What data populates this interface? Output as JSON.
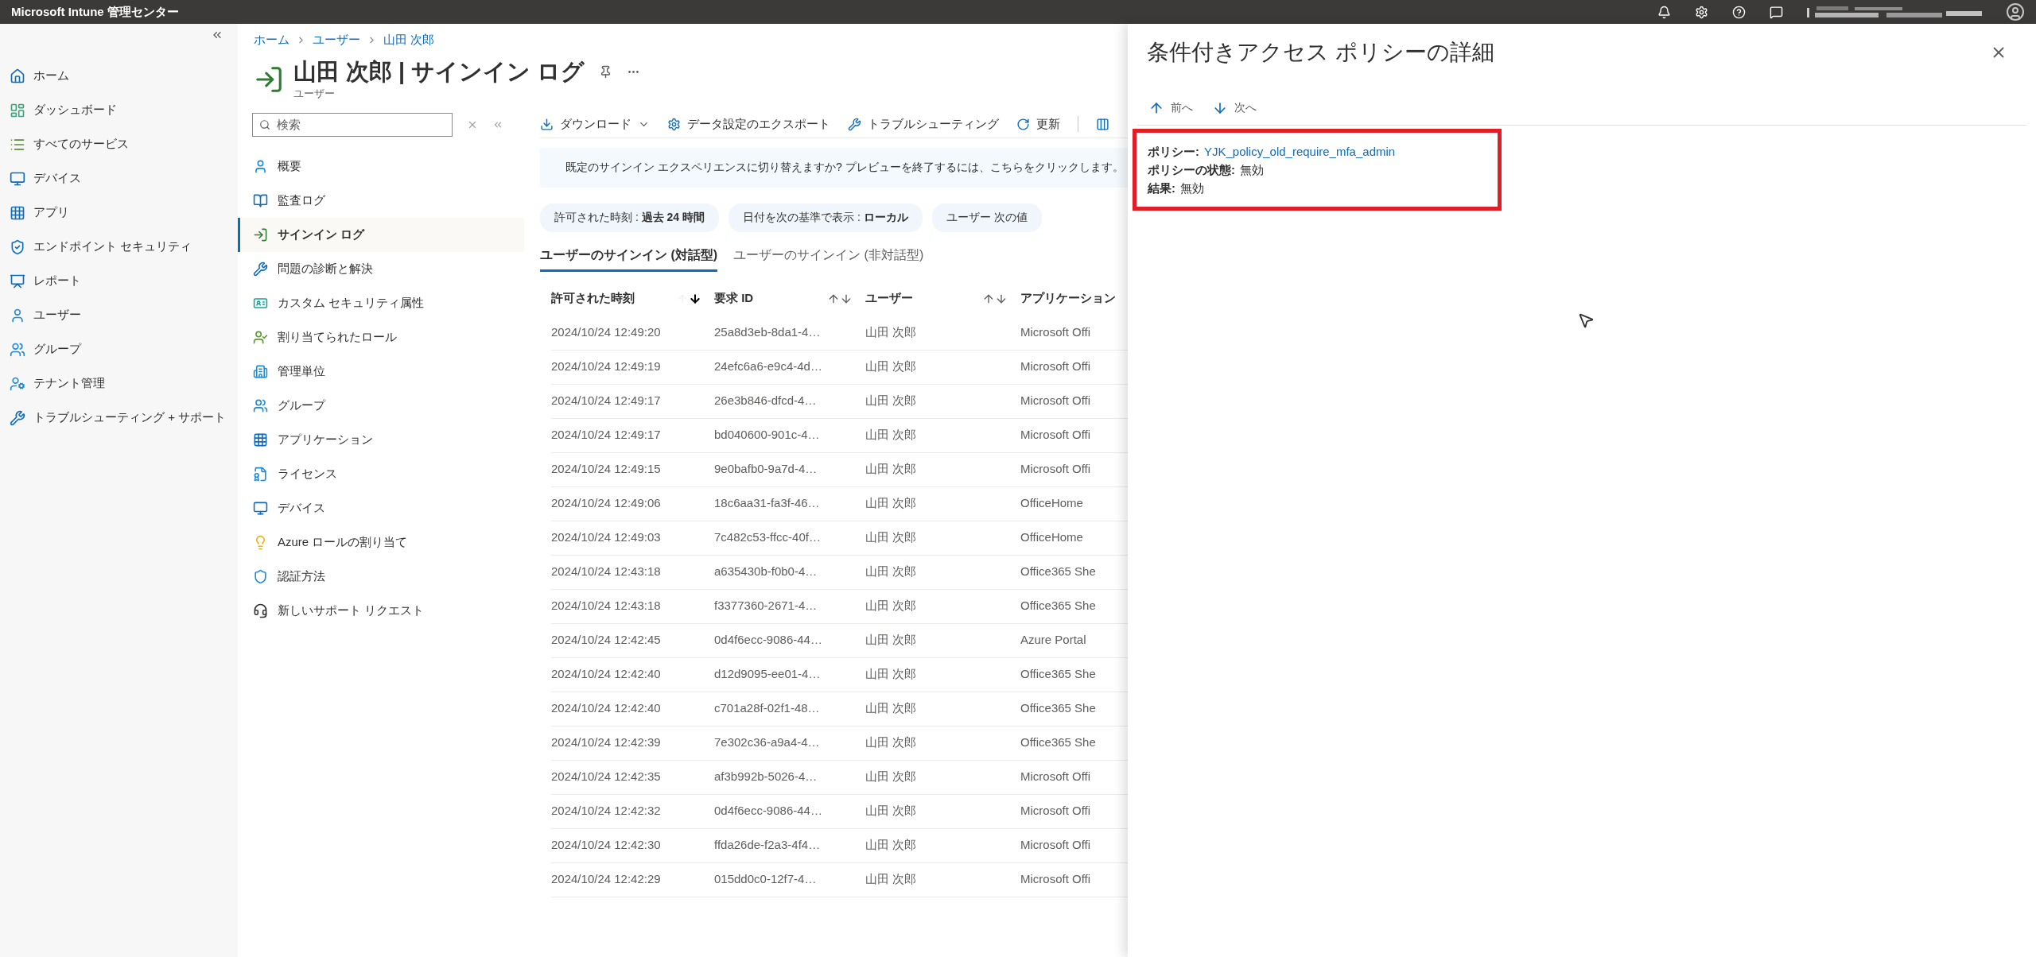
{
  "top_bar": {
    "title": "Microsoft Intune 管理センター"
  },
  "left_nav": {
    "items": [
      {
        "label": "ホーム"
      },
      {
        "label": "ダッシュボード"
      },
      {
        "label": "すべてのサービス"
      },
      {
        "label": "デバイス"
      },
      {
        "label": "アプリ"
      },
      {
        "label": "エンドポイント セキュリティ"
      },
      {
        "label": "レポート"
      },
      {
        "label": "ユーザー"
      },
      {
        "label": "グループ"
      },
      {
        "label": "テナント管理"
      },
      {
        "label": "トラブルシューティング + サポート"
      }
    ]
  },
  "breadcrumb": [
    "ホーム",
    "ユーザー",
    "山田 次郎"
  ],
  "blade": {
    "title": "山田 次郎 | サインイン ログ",
    "subtitle": "ユーザー"
  },
  "resource_menu": {
    "search": {
      "placeholder": "検索"
    },
    "items": [
      {
        "label": "概要",
        "selected": false
      },
      {
        "label": "監査ログ",
        "selected": false
      },
      {
        "label": "サインイン ログ",
        "selected": true
      },
      {
        "label": "問題の診断と解決",
        "selected": false
      },
      {
        "label": "カスタム セキュリティ属性",
        "selected": false
      },
      {
        "label": "割り当てられたロール",
        "selected": false
      },
      {
        "label": "管理単位",
        "selected": false
      },
      {
        "label": "グループ",
        "selected": false
      },
      {
        "label": "アプリケーション",
        "selected": false
      },
      {
        "label": "ライセンス",
        "selected": false
      },
      {
        "label": "デバイス",
        "selected": false
      },
      {
        "label": "Azure ロールの割り当て",
        "selected": false
      },
      {
        "label": "認証方法",
        "selected": false
      },
      {
        "label": "新しいサポート リクエスト",
        "selected": false
      }
    ]
  },
  "toolbar": {
    "buttons": [
      {
        "label": "ダウンロード",
        "kind": "dropdown"
      },
      {
        "label": "データ設定のエクスポート",
        "kind": "plain"
      },
      {
        "label": "トラブルシューティング",
        "kind": "plain"
      },
      {
        "label": "更新",
        "kind": "plain"
      }
    ]
  },
  "banner": {
    "text": "既定のサインイン エクスペリエンスに切り替えますか? プレビューを終了するには、こちらをクリックします。"
  },
  "filters": [
    "許可された時刻 : **過去 24 時間**",
    "日付を次の基準で表示 : **ローカル**",
    "ユーザー 次の値"
  ],
  "tabs": [
    {
      "label": "ユーザーのサインイン (対話型)",
      "selected": true
    },
    {
      "label": "ユーザーのサインイン (非対話型)",
      "selected": false
    }
  ],
  "table": {
    "columns": [
      {
        "label": "許可された時刻",
        "sortable": true,
        "sorted": true
      },
      {
        "label": "要求 ID",
        "sortable": true,
        "sorted": false
      },
      {
        "label": "ユーザー",
        "sortable": true,
        "sorted": false
      },
      {
        "label": "アプリケーション"
      }
    ],
    "rows": [
      {
        "time": "2024/10/24 12:49:20",
        "id": "25a8d3eb-8da1-4…",
        "user": "山田 次郎",
        "app": "Microsoft Offi"
      },
      {
        "time": "2024/10/24 12:49:19",
        "id": "24efc6a6-e9c4-4d…",
        "user": "山田 次郎",
        "app": "Microsoft Offi"
      },
      {
        "time": "2024/10/24 12:49:17",
        "id": "26e3b846-dfcd-4…",
        "user": "山田 次郎",
        "app": "Microsoft Offi"
      },
      {
        "time": "2024/10/24 12:49:17",
        "id": "bd040600-901c-4…",
        "user": "山田 次郎",
        "app": "Microsoft Offi"
      },
      {
        "time": "2024/10/24 12:49:15",
        "id": "9e0bafb0-9a7d-4…",
        "user": "山田 次郎",
        "app": "Microsoft Offi"
      },
      {
        "time": "2024/10/24 12:49:06",
        "id": "18c6aa31-fa3f-46…",
        "user": "山田 次郎",
        "app": "OfficeHome"
      },
      {
        "time": "2024/10/24 12:49:03",
        "id": "7c482c53-ffcc-40f…",
        "user": "山田 次郎",
        "app": "OfficeHome"
      },
      {
        "time": "2024/10/24 12:43:18",
        "id": "a635430b-f0b0-4…",
        "user": "山田 次郎",
        "app": "Office365 She"
      },
      {
        "time": "2024/10/24 12:43:18",
        "id": "f3377360-2671-4…",
        "user": "山田 次郎",
        "app": "Office365 She"
      },
      {
        "time": "2024/10/24 12:42:45",
        "id": "0d4f6ecc-9086-44…",
        "user": "山田 次郎",
        "app": "Azure Portal"
      },
      {
        "time": "2024/10/24 12:42:40",
        "id": "d12d9095-ee01-4…",
        "user": "山田 次郎",
        "app": "Office365 She"
      },
      {
        "time": "2024/10/24 12:42:40",
        "id": "c701a28f-02f1-48…",
        "user": "山田 次郎",
        "app": "Office365 She"
      },
      {
        "time": "2024/10/24 12:42:39",
        "id": "7e302c36-a9a4-4…",
        "user": "山田 次郎",
        "app": "Office365 She"
      },
      {
        "time": "2024/10/24 12:42:35",
        "id": "af3b992b-5026-4…",
        "user": "山田 次郎",
        "app": "Microsoft Offi"
      },
      {
        "time": "2024/10/24 12:42:32",
        "id": "0d4f6ecc-9086-44…",
        "user": "山田 次郎",
        "app": "Microsoft Offi"
      },
      {
        "time": "2024/10/24 12:42:30",
        "id": "ffda26de-f2a3-4f4…",
        "user": "山田 次郎",
        "app": "Microsoft Offi"
      },
      {
        "time": "2024/10/24 12:42:29",
        "id": "015dd0c0-12f7-4…",
        "user": "山田 次郎",
        "app": "Microsoft Offi"
      }
    ]
  },
  "panel": {
    "title": "条件付きアクセス ポリシーの詳細",
    "nav": [
      "前へ",
      "次へ"
    ],
    "details_highlighted": true,
    "details": [
      {
        "label": "ポリシー:",
        "value": "YJK_policy_old_require_mfa_admin",
        "kind": "link"
      },
      {
        "label": "ポリシーの状態:",
        "value": "無効",
        "kind": "text"
      },
      {
        "label": "結果:",
        "value": "無効",
        "kind": "text"
      }
    ]
  }
}
